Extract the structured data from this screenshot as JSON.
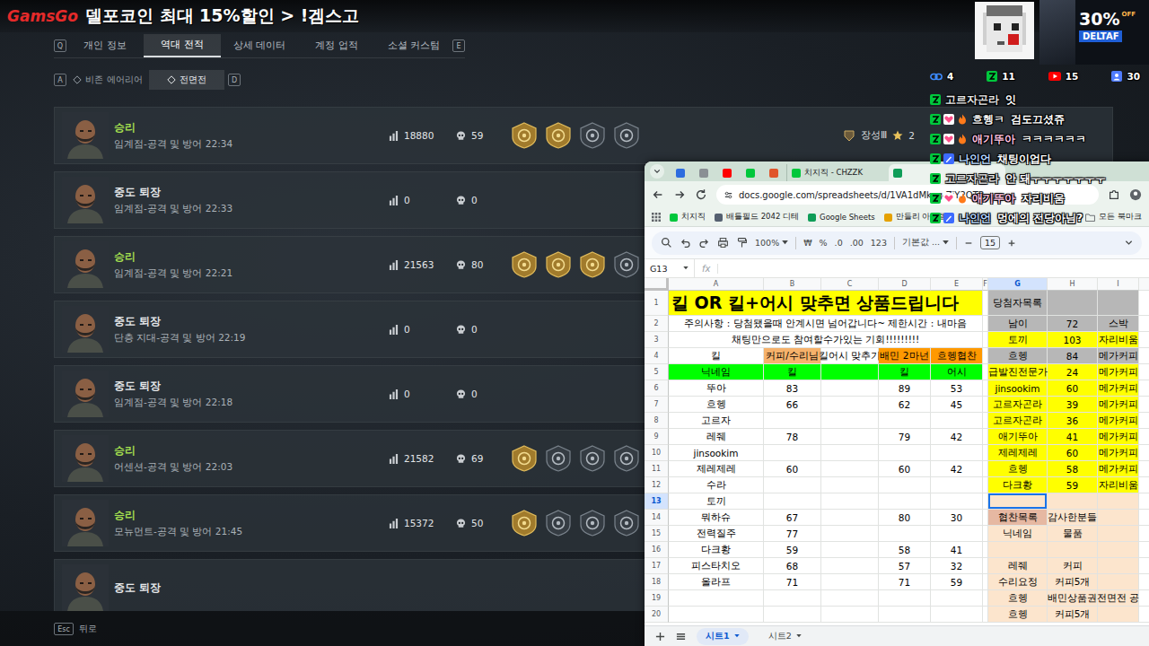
{
  "stream_ad": {
    "brand": "GamsGo",
    "text": "델포코인 최대 15%할인 > !겜스고"
  },
  "game": {
    "tab_keys": {
      "prev": "Q",
      "next": "E"
    },
    "tabs": [
      {
        "label": "개인 정보",
        "selected": false
      },
      {
        "label": "역대 전적",
        "selected": true
      },
      {
        "label": "상세 데이터",
        "selected": false
      },
      {
        "label": "계정 업적",
        "selected": false
      },
      {
        "label": "소셜 커스텀",
        "selected": false
      }
    ],
    "subtab_keys": {
      "prev": "A",
      "next": "D"
    },
    "subtabs": [
      {
        "label": "비존 에어리어",
        "selected": false
      },
      {
        "label": "전면전",
        "selected": true
      }
    ],
    "matches": [
      {
        "result": "승리",
        "win": true,
        "mode": "임계점-공격 및 방어 22:34",
        "score": "18880",
        "kills": "59",
        "medals": [
          {
            "gold": true
          },
          {
            "gold": true
          },
          {
            "gold": false
          },
          {
            "gold": false
          }
        ],
        "rank": "장성Ⅲ",
        "rank_stars": "2"
      },
      {
        "result": "중도 퇴장",
        "win": false,
        "mode": "임계점-공격 및 방어 22:33",
        "score": "0",
        "kills": "0",
        "medals": []
      },
      {
        "result": "승리",
        "win": true,
        "mode": "임계점-공격 및 방어 22:21",
        "score": "21563",
        "kills": "80",
        "medals": [
          {
            "gold": true
          },
          {
            "gold": true
          },
          {
            "gold": true
          },
          {
            "gold": false
          }
        ]
      },
      {
        "result": "중도 퇴장",
        "win": false,
        "mode": "단층 지대-공격 및 방어 22:19",
        "score": "0",
        "kills": "0",
        "medals": []
      },
      {
        "result": "중도 퇴장",
        "win": false,
        "mode": "임계점-공격 및 방어 22:18",
        "score": "0",
        "kills": "0",
        "medals": []
      },
      {
        "result": "승리",
        "win": true,
        "mode": "어센션-공격 및 방어 22:03",
        "score": "21582",
        "kills": "69",
        "medals": [
          {
            "gold": true
          },
          {
            "gold": false
          },
          {
            "gold": false
          },
          {
            "gold": false
          }
        ]
      },
      {
        "result": "승리",
        "win": true,
        "mode": "모뉴먼트-공격 및 방어 21:45",
        "score": "15372",
        "kills": "50",
        "medals": [
          {
            "gold": true
          },
          {
            "gold": false
          },
          {
            "gold": false
          },
          {
            "gold": false
          }
        ]
      },
      {
        "result": "중도 퇴장",
        "win": false
      }
    ],
    "back": {
      "key": "Esc",
      "label": "뒤로"
    }
  },
  "overlay": {
    "promo": {
      "discount": "30%",
      "off": "OFF",
      "brand": "DELTAF"
    },
    "stats": [
      {
        "kind": "link",
        "value": "4",
        "color": "#3d8bff"
      },
      {
        "kind": "chzzk",
        "value": "11",
        "color": "#00c73c"
      },
      {
        "kind": "youtube",
        "value": "15",
        "color": "#ff0000"
      },
      {
        "kind": "viewers",
        "value": "30",
        "color": "#4f7cff"
      }
    ],
    "chat": [
      {
        "user": "고르자곤라",
        "message": "잇",
        "color": "#e6e6e6",
        "kind": "plain"
      },
      {
        "user": "흐헹ㅋ",
        "message": "검도끄셨쥬",
        "color": "#f4f4f4",
        "kind": "subscriber"
      },
      {
        "user": "애기뚜아",
        "message": "ㅋㅋㅋㅋㅋㅋ",
        "color": "#ffc2e0",
        "kind": "subscriber"
      },
      {
        "user": "나인언",
        "message": "채팅이업다",
        "color": "#b3d6ff",
        "kind": "manager"
      },
      {
        "user": "고르자곤라",
        "message": "안 돼ㅜㅜㅜㅜㅜㅜㅜ",
        "color": "#e6e6e6",
        "kind": "plain"
      },
      {
        "user": "애기뚜아",
        "message": "자리비움",
        "color": "#ffc2e0",
        "kind": "subscriber"
      },
      {
        "user": "나인언",
        "message": "멍에의 전당아님?",
        "color": "#b3d6ff",
        "kind": "manager"
      }
    ]
  },
  "browser": {
    "tabs": [
      {
        "color": "#2d6cdf",
        "selected": false
      },
      {
        "color": "#8a8f94",
        "selected": false
      },
      {
        "color": "#ff0000",
        "selected": false
      },
      {
        "color": "#00c73c",
        "selected": false
      },
      {
        "color": "#e0552b",
        "selected": false
      },
      {
        "label": "치지직 - CHZZK",
        "color": "#00c73c",
        "selected": false
      },
      {
        "color": "#0f9d58",
        "selected": true
      }
    ],
    "url": "docs.google.com/spreadsheets/d/1VA1dMkag-ZiY2QTR",
    "bookmarks": [
      {
        "label": "치지직",
        "color": "#00c73c"
      },
      {
        "label": "배틀필드 2042 디테",
        "color": "#556070"
      },
      {
        "label": "Google Sheets",
        "color": "#0f9d58"
      },
      {
        "label": "만들리 아이템",
        "color": "#e5a100"
      }
    ],
    "all_bookmarks": "모든 북마크"
  },
  "sheet": {
    "toolbar": {
      "zoom": "100%",
      "currency": "₩",
      "percent": "%",
      "dec_less": ".0",
      "dec_more": ".00",
      "format": "123",
      "font": "기본값 ...",
      "font_size": "15"
    },
    "cell_ref": "G13",
    "fx": "fx",
    "columns": [
      "A",
      "B",
      "C",
      "D",
      "E",
      "F",
      "G",
      "H",
      "I"
    ],
    "rows": [
      {
        "row": "1",
        "cells": [
          {
            "col": "A",
            "span": 5,
            "text": "킬 OR 킬+어시 맞추면 상품드립니다",
            "color": "#ffff00",
            "kind": "title"
          },
          {
            "col": "G",
            "text": "당첨자목록",
            "color": "#b7b7b7"
          },
          {
            "col": "H",
            "color": "#b7b7b7"
          },
          {
            "col": "I",
            "color": "#b7b7b7"
          }
        ]
      },
      {
        "row": "2",
        "cells": [
          {
            "col": "A",
            "span": 5,
            "text": "주의사항 : 당첨됐을때 안계시면 넘어갑니다~ 제한시간 : 내마음"
          },
          {
            "col": "G",
            "text": "남이",
            "color": "#b7b7b7"
          },
          {
            "col": "H",
            "text": "72",
            "color": "#b7b7b7"
          },
          {
            "col": "I",
            "text": "스박",
            "color": "#b7b7b7"
          }
        ]
      },
      {
        "row": "3",
        "cells": [
          {
            "col": "A",
            "span": 5,
            "text": "채팅만으로도 참여할수가있는 기회!!!!!!!!!"
          },
          {
            "col": "G",
            "text": "토끼",
            "color": "#ffff00"
          },
          {
            "col": "H",
            "text": "103",
            "color": "#ffff00"
          },
          {
            "col": "I",
            "text": "자리비움",
            "color": "#ffff00"
          }
        ]
      },
      {
        "row": "4",
        "cells": [
          {
            "col": "A",
            "text": "킬"
          },
          {
            "col": "B",
            "text": "커피/수리님",
            "color": "#f6b26b"
          },
          {
            "col": "C",
            "text": "킬어시 맞추기"
          },
          {
            "col": "D",
            "text": "배민 2마넌",
            "color": "#ff9900"
          },
          {
            "col": "E",
            "text": "흐헹협찬",
            "color": "#ff9900"
          },
          {
            "col": "G",
            "text": "흐헹",
            "color": "#b7b7b7"
          },
          {
            "col": "H",
            "text": "84",
            "color": "#b7b7b7"
          },
          {
            "col": "I",
            "text": "메가커피",
            "color": "#b7b7b7"
          }
        ]
      },
      {
        "row": "5",
        "cells": [
          {
            "col": "A",
            "text": "닉네임",
            "color": "#00ff00"
          },
          {
            "col": "B",
            "text": "킬",
            "color": "#00ff00"
          },
          {
            "col": "C",
            "color": "#00ff00"
          },
          {
            "col": "D",
            "text": "킬",
            "color": "#00ff00"
          },
          {
            "col": "E",
            "text": "어시",
            "color": "#00ff00"
          },
          {
            "col": "G",
            "text": "급발진전문가",
            "color": "#ffff00"
          },
          {
            "col": "H",
            "text": "24",
            "color": "#ffff00"
          },
          {
            "col": "I",
            "text": "메가커피",
            "color": "#ffff00"
          }
        ]
      },
      {
        "row": "6",
        "cells": [
          {
            "col": "A",
            "text": "뚜아"
          },
          {
            "col": "B",
            "text": "83"
          },
          {
            "col": "D",
            "text": "89"
          },
          {
            "col": "E",
            "text": "53"
          },
          {
            "col": "G",
            "text": "jinsookim",
            "color": "#ffff00"
          },
          {
            "col": "H",
            "text": "60",
            "color": "#ffff00"
          },
          {
            "col": "I",
            "text": "메가커피",
            "color": "#ffff00"
          }
        ]
      },
      {
        "row": "7",
        "cells": [
          {
            "col": "A",
            "text": "흐헹"
          },
          {
            "col": "B",
            "text": "66"
          },
          {
            "col": "D",
            "text": "62"
          },
          {
            "col": "E",
            "text": "45"
          },
          {
            "col": "G",
            "text": "고르자곤라",
            "color": "#ffff00"
          },
          {
            "col": "H",
            "text": "39",
            "color": "#ffff00"
          },
          {
            "col": "I",
            "text": "메가커피",
            "color": "#ffff00"
          }
        ]
      },
      {
        "row": "8",
        "cells": [
          {
            "col": "A",
            "text": "고르자"
          },
          {
            "col": "G",
            "text": "고르자곤라",
            "color": "#ffff00"
          },
          {
            "col": "H",
            "text": "36",
            "color": "#ffff00"
          },
          {
            "col": "I",
            "text": "메가커피",
            "color": "#ffff00"
          }
        ]
      },
      {
        "row": "9",
        "cells": [
          {
            "col": "A",
            "text": "레줴"
          },
          {
            "col": "B",
            "text": "78"
          },
          {
            "col": "D",
            "text": "79"
          },
          {
            "col": "E",
            "text": "42"
          },
          {
            "col": "G",
            "text": "애기뚜아",
            "color": "#ffff00"
          },
          {
            "col": "H",
            "text": "41",
            "color": "#ffff00"
          },
          {
            "col": "I",
            "text": "메가커피",
            "color": "#ffff00"
          }
        ]
      },
      {
        "row": "10",
        "cells": [
          {
            "col": "A",
            "text": "jinsookim"
          },
          {
            "col": "G",
            "text": "제레제레",
            "color": "#ffff00"
          },
          {
            "col": "H",
            "text": "60",
            "color": "#ffff00"
          },
          {
            "col": "I",
            "text": "메가커피",
            "color": "#ffff00"
          }
        ]
      },
      {
        "row": "11",
        "cells": [
          {
            "col": "A",
            "text": "제레제레"
          },
          {
            "col": "B",
            "text": "60"
          },
          {
            "col": "D",
            "text": "60"
          },
          {
            "col": "E",
            "text": "42"
          },
          {
            "col": "G",
            "text": "흐헹",
            "color": "#ffff00"
          },
          {
            "col": "H",
            "text": "58",
            "color": "#ffff00"
          },
          {
            "col": "I",
            "text": "메가커피",
            "color": "#ffff00"
          }
        ]
      },
      {
        "row": "12",
        "cells": [
          {
            "col": "A",
            "text": "수라"
          },
          {
            "col": "G",
            "text": "다크황",
            "color": "#ffff00"
          },
          {
            "col": "H",
            "text": "59",
            "color": "#ffff00"
          },
          {
            "col": "I",
            "text": "자리비움",
            "color": "#ffff00"
          }
        ]
      },
      {
        "row": "13",
        "cells": [
          {
            "col": "A",
            "text": "토끼"
          },
          {
            "col": "G",
            "color": "#fce5cd"
          },
          {
            "col": "H",
            "color": "#fce5cd"
          },
          {
            "col": "I",
            "color": "#fce5cd"
          }
        ]
      },
      {
        "row": "14",
        "cells": [
          {
            "col": "A",
            "text": "뭐하슈"
          },
          {
            "col": "B",
            "text": "67"
          },
          {
            "col": "D",
            "text": "80"
          },
          {
            "col": "E",
            "text": "30"
          },
          {
            "col": "G",
            "text": "협찬목록",
            "color": "#e6b8a2"
          },
          {
            "col": "H",
            "text": "감사한분들",
            "color": "#fce5cd"
          },
          {
            "col": "I",
            "color": "#fce5cd"
          }
        ]
      },
      {
        "row": "15",
        "cells": [
          {
            "col": "A",
            "text": "전력질주"
          },
          {
            "col": "B",
            "text": "77"
          },
          {
            "col": "G",
            "text": "닉네임",
            "color": "#fce5cd"
          },
          {
            "col": "H",
            "text": "물품",
            "color": "#fce5cd"
          },
          {
            "col": "I",
            "color": "#fce5cd"
          }
        ]
      },
      {
        "row": "16",
        "cells": [
          {
            "col": "A",
            "text": "다크황"
          },
          {
            "col": "B",
            "text": "59"
          },
          {
            "col": "D",
            "text": "58"
          },
          {
            "col": "E",
            "text": "41"
          },
          {
            "col": "G",
            "color": "#fce5cd"
          },
          {
            "col": "H",
            "color": "#fce5cd"
          },
          {
            "col": "I",
            "color": "#fce5cd"
          }
        ]
      },
      {
        "row": "17",
        "cells": [
          {
            "col": "A",
            "text": "피스타치오"
          },
          {
            "col": "B",
            "text": "68"
          },
          {
            "col": "D",
            "text": "57"
          },
          {
            "col": "E",
            "text": "32"
          },
          {
            "col": "G",
            "text": "레줴",
            "color": "#fce5cd"
          },
          {
            "col": "H",
            "text": "커피",
            "color": "#fce5cd"
          },
          {
            "col": "I",
            "color": "#fce5cd"
          }
        ]
      },
      {
        "row": "18",
        "cells": [
          {
            "col": "A",
            "text": "올라프"
          },
          {
            "col": "B",
            "text": "71"
          },
          {
            "col": "D",
            "text": "71"
          },
          {
            "col": "E",
            "text": "59"
          },
          {
            "col": "G",
            "text": "수리요정",
            "color": "#fce5cd"
          },
          {
            "col": "H",
            "text": "커피5개",
            "color": "#fce5cd"
          },
          {
            "col": "I",
            "color": "#fce5cd"
          }
        ]
      },
      {
        "row": "19",
        "cells": [
          {
            "col": "G",
            "text": "흐헹",
            "color": "#fce5cd"
          },
          {
            "col": "H",
            "text": "배민상품권",
            "color": "#fce5cd"
          },
          {
            "col": "I",
            "text": "전면전 공",
            "color": "#fce5cd"
          }
        ]
      },
      {
        "row": "20",
        "cells": [
          {
            "col": "G",
            "text": "흐헹",
            "color": "#fce5cd"
          },
          {
            "col": "H",
            "text": "커피5개",
            "color": "#fce5cd"
          },
          {
            "col": "I",
            "color": "#fce5cd"
          }
        ]
      }
    ],
    "sheets": [
      {
        "label": "시트1",
        "selected": true
      },
      {
        "label": "시트2",
        "selected": false
      }
    ]
  }
}
